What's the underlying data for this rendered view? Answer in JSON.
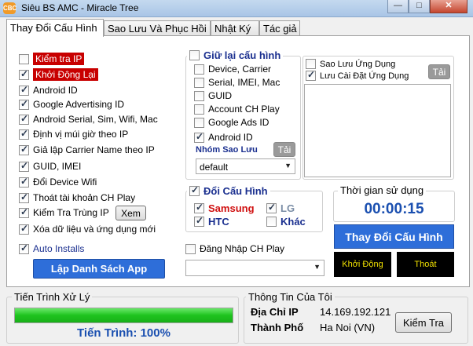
{
  "window": {
    "title": "Siêu BS AMC - Miracle Tree",
    "icon_text": "CBC",
    "minimize_label": "—",
    "maximize_label": "□",
    "close_label": "✕"
  },
  "tabs": [
    {
      "label": "Thay Đổi Cấu Hình",
      "active": true
    },
    {
      "label": "Sao Lưu Và Phục Hồi",
      "active": false
    },
    {
      "label": "Nhật Ký",
      "active": false
    },
    {
      "label": "Tác giả",
      "active": false
    }
  ],
  "left_options": [
    {
      "label": "Kiểm tra IP",
      "checked": false,
      "highlight": true
    },
    {
      "label": "Khởi Động Lại",
      "checked": true,
      "highlight": true
    },
    {
      "label": "Android ID",
      "checked": true,
      "highlight": false
    },
    {
      "label": "Google Advertising ID",
      "checked": true,
      "highlight": false
    },
    {
      "label": "Android Serial, Sim, Wifi, Mac",
      "checked": true,
      "highlight": false
    },
    {
      "label": "Định vị múi giờ theo IP",
      "checked": true,
      "highlight": false
    },
    {
      "label": "Giả lập Carrier Name theo IP",
      "checked": true,
      "highlight": false
    },
    {
      "label": "GUID, IMEI",
      "checked": true,
      "highlight": false
    },
    {
      "label": "Đổi Device Wifi",
      "checked": true,
      "highlight": false
    },
    {
      "label": "Thoát tài khoản CH Play",
      "checked": true,
      "highlight": false
    },
    {
      "label": "Kiểm Tra Trùng IP",
      "checked": true,
      "highlight": false
    },
    {
      "label": "Xóa dữ liệu và ứng dụng mới",
      "checked": true,
      "highlight": false
    }
  ],
  "xem_button": "Xem",
  "auto_installs": {
    "label": "Auto Installs",
    "checked": true
  },
  "lap_danh_sach_button": "Lập Danh Sách App",
  "keep_config": {
    "title": "Giữ lại cấu hình",
    "checked": false,
    "items": [
      {
        "label": "Device, Carrier",
        "checked": false
      },
      {
        "label": "Serial, IMEI, Mac",
        "checked": false
      },
      {
        "label": "GUID",
        "checked": false
      },
      {
        "label": "Account CH Play",
        "checked": false
      },
      {
        "label": "Google Ads ID",
        "checked": false
      },
      {
        "label": "Android ID",
        "checked": true
      }
    ],
    "backup_group_label": "Nhóm Sao Lưu",
    "tai_button": "Tải",
    "group_select": "default"
  },
  "backup": {
    "items": [
      {
        "label": "Sao Lưu Ứng Dụng",
        "checked": false
      },
      {
        "label": "Lưu Cài Đặt Ứng Dụng",
        "checked": true
      }
    ],
    "tai_button": "Tải"
  },
  "change_config": {
    "title": "Đổi Cấu Hình",
    "checked": true,
    "brands": [
      {
        "label": "Samsung",
        "checked": true,
        "color": "#d01010"
      },
      {
        "label": "LG",
        "checked": true,
        "color": "#7a8da6"
      },
      {
        "label": "HTC",
        "checked": true,
        "color": "#1a2f8f"
      },
      {
        "label": "Khác",
        "checked": false,
        "color": "#1a2f8f"
      }
    ]
  },
  "timer": {
    "label": "Thời gian sử dụng",
    "value": "00:00:15",
    "color": "#1a4fb0"
  },
  "change_button": "Thay Đổi Cấu Hình",
  "restart_button": "Khởi Động",
  "exit_button": "Thoát",
  "chplay_login": {
    "label": "Đăng Nhập CH Play",
    "checked": false,
    "select_value": ""
  },
  "progress": {
    "title": "Tiến Trình Xử Lý",
    "percent": 100,
    "text": "Tiến Trình: 100%",
    "text_color": "#1a4fb0"
  },
  "info": {
    "title": "Thông Tin Của Tôi",
    "ip_label": "Địa Chỉ IP",
    "ip_value": "14.169.192.121",
    "city_label": "Thành Phố",
    "city_value": "Ha Noi (VN)",
    "check_button": "Kiểm Tra"
  }
}
